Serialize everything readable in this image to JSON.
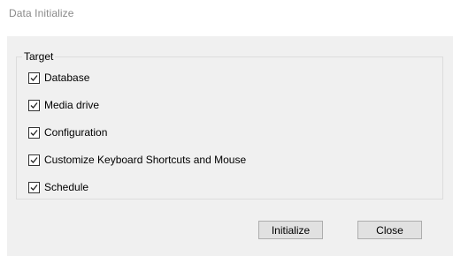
{
  "window": {
    "title": "Data Initialize"
  },
  "target_group": {
    "legend": "Target",
    "items": [
      {
        "label": "Database",
        "checked": true
      },
      {
        "label": "Media drive",
        "checked": true
      },
      {
        "label": "Configuration",
        "checked": true
      },
      {
        "label": "Customize Keyboard Shortcuts and Mouse",
        "checked": true
      },
      {
        "label": "Schedule",
        "checked": true
      }
    ]
  },
  "buttons": {
    "initialize_label": "Initialize",
    "close_label": "Close"
  }
}
